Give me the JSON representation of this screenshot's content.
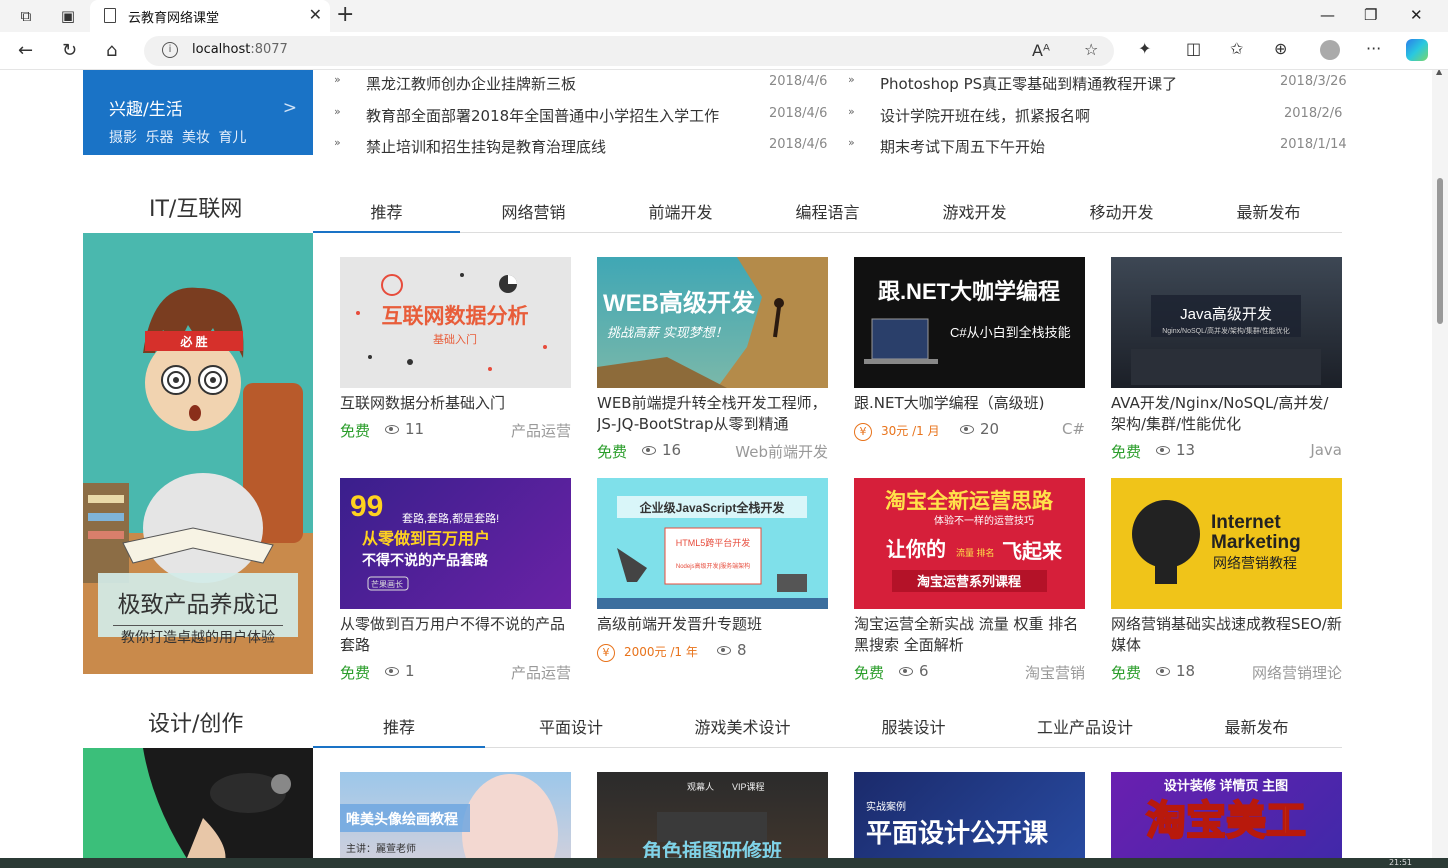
{
  "browser": {
    "tab_title": "云教育网络课堂",
    "url_host": "localhost",
    "url_port": ":8077",
    "taskbar_time": "21:51"
  },
  "interest": {
    "heading": "兴趣/生活",
    "arrow": ">",
    "sub": "摄影 乐器 美妆 育儿"
  },
  "news": {
    "bullet": "»",
    "left": [
      {
        "title": "黑龙江教师创办企业挂牌新三板",
        "date": "2018/4/6"
      },
      {
        "title": "教育部全面部署2018年全国普通中小学招生入学工作",
        "date": "2018/4/6"
      },
      {
        "title": "禁止培训和招生挂钩是教育治理底线",
        "date": "2018/4/6"
      }
    ],
    "right": [
      {
        "title": "Photoshop PS真正零基础到精通教程开课了",
        "date": "2018/3/26"
      },
      {
        "title": "设计学院开班在线，抓紧报名啊",
        "date": "2018/2/6"
      },
      {
        "title": "期末考试下周五下午开始",
        "date": "2018/1/14"
      }
    ]
  },
  "it_section": {
    "title": "IT/互联网",
    "tabs": [
      "推荐",
      "网络营销",
      "前端开发",
      "编程语言",
      "游戏开发",
      "移动开发",
      "最新发布"
    ],
    "banner": {
      "title": "极致产品养成记",
      "subtitle": "教你打造卓越的用户体验",
      "headband": "必 胜"
    },
    "courses": [
      {
        "image_text": "互联网数据分析",
        "image_sub": "基础入门",
        "title": "互联网数据分析基础入门",
        "price": "免费",
        "views": "11",
        "category": "产品运营"
      },
      {
        "image_text": "WEB高级开发",
        "image_sub": "挑战高薪 实现梦想！",
        "title": "WEB前端提升转全栈开发工程师，JS-JQ-BootStrap从零到精通",
        "price": "免费",
        "views": "16",
        "category": "Web前端开发"
      },
      {
        "image_text": "跟.NET大咖学编程",
        "image_sub": "C#从小白到全栈技能",
        "title": "跟.NET大咖学编程（高级班)",
        "price_icon": "¥",
        "price": "30元 /1 月",
        "views": "20",
        "category": "C#"
      },
      {
        "image_text": "Java高级开发",
        "image_sub": "Nginx/NoSQL/高并发/架构/集群/性能优化",
        "title": "AVA开发/Nginx/NoSQL/高并发/架构/集群/性能优化",
        "price": "免费",
        "views": "13",
        "category": "Java"
      },
      {
        "image_text": "套路,套路,都是套路!",
        "image_line1": "从零做到百万用户",
        "image_line2": "不得不说的产品套路",
        "image_tag": "芒果画长",
        "image_mark": "99",
        "title": "从零做到百万用户不得不说的产品套路",
        "price": "免费",
        "views": "1",
        "category": "产品运营"
      },
      {
        "image_text": "企业级JavaScript全栈开发",
        "image_sub": "HTML5跨平台开发",
        "image_sub2": "Nodejs高级开发|服务端架构",
        "title": "高级前端开发晋升专题班",
        "price_icon": "¥",
        "price": "2000元 /1 年",
        "views": "8",
        "category": ""
      },
      {
        "image_text": "淘宝全新运营思路",
        "image_sub": "体验不一样的运营技巧",
        "image_line1": "让你的",
        "image_line2": "飞起来",
        "image_small": "流量 排名",
        "image_tag": "淘宝运营系列课程",
        "title": "淘宝运营全新实战 流量 权重 排名 黑搜索 全面解析",
        "price": "免费",
        "views": "6",
        "category": "淘宝营销"
      },
      {
        "image_text": "Internet",
        "image_sub": "Marketing",
        "image_line1": "网络营销教程",
        "title": "网络营销基础实战速成教程SEO/新媒体",
        "price": "免费",
        "views": "18",
        "category": "网络营销理论"
      }
    ]
  },
  "design_section": {
    "title": "设计/创作",
    "tabs": [
      "推荐",
      "平面设计",
      "游戏美术设计",
      "服装设计",
      "工业产品设计",
      "最新发布"
    ],
    "courses": [
      {
        "image_text": "唯美头像绘画教程",
        "image_sub": "主讲：麗萱老师"
      },
      {
        "image_text": "角色插图研修班",
        "image_sub": "VIP课程",
        "image_tag": "观幕人"
      },
      {
        "image_text": "平面设计公开课",
        "image_sub": "实战案例"
      },
      {
        "image_text": "淘宝美工",
        "image_sub": "设计装修 详情页 主图"
      }
    ]
  },
  "colors": {
    "accent": "#1a73c6",
    "free": "#2a9d2a",
    "price": "#e8731b"
  }
}
